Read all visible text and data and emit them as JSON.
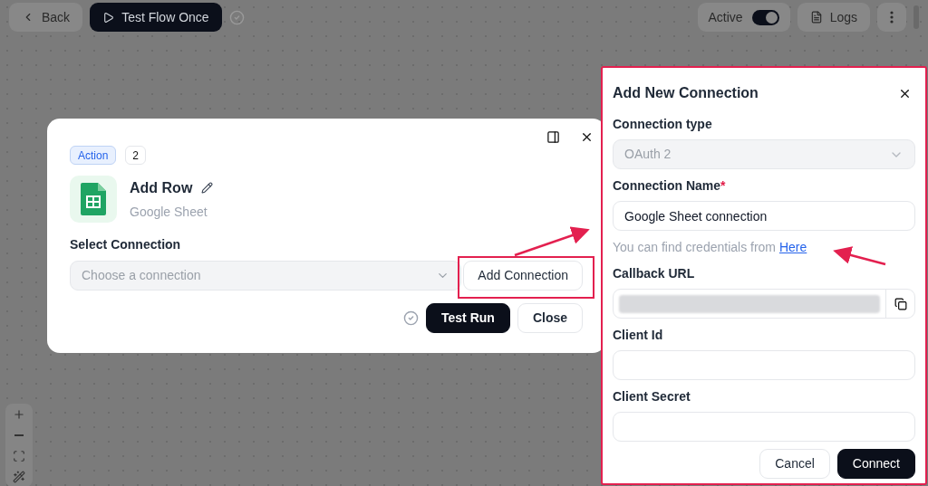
{
  "top_bar": {
    "back_button": "Back",
    "test_button": "Test Flow Once",
    "active_toggle": {
      "label": "Active",
      "on": true
    },
    "logs_button": "Logs"
  },
  "step_dialog": {
    "badge": "Action",
    "count": "2",
    "title": "Add Row",
    "subtitle": "Google Sheet",
    "select_label": "Select Connection",
    "select_placeholder": "Choose a connection",
    "add_connection_button": "Add Connection",
    "buttons": [
      {
        "label": "Test Run",
        "kind": "primary"
      },
      {
        "label": "Close",
        "kind": "secondary"
      }
    ]
  },
  "connection_panel": {
    "title": "Add New Connection",
    "fields": [
      {
        "kind": "select",
        "label": "Connection type",
        "value": "OAuth 2",
        "disabled": true
      },
      {
        "kind": "text",
        "label": "Connection Name",
        "required_mark": "*",
        "value": "Google Sheet connection"
      },
      {
        "kind": "hint",
        "text": "You can find credentials from",
        "link": "Here"
      },
      {
        "kind": "copy",
        "label": "Callback URL"
      },
      {
        "kind": "text",
        "label": "Client Id"
      },
      {
        "kind": "text",
        "label": "Client Secret"
      }
    ],
    "buttons": [
      {
        "label": "Cancel",
        "kind": "secondary"
      },
      {
        "label": "Connect",
        "kind": "primary"
      }
    ]
  }
}
